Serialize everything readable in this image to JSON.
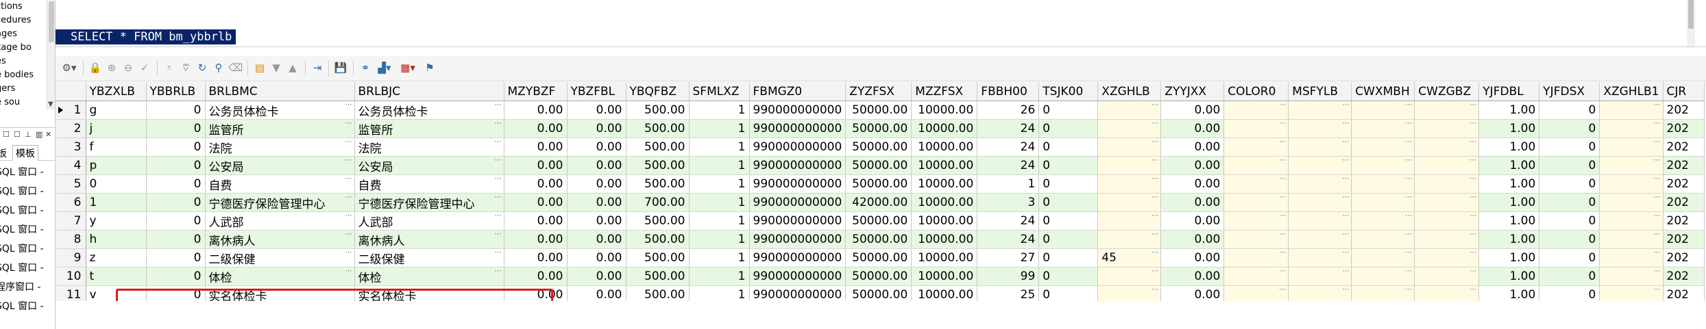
{
  "object_tree": [
    "ctions",
    "cedures",
    "ages",
    "kage bo",
    "es",
    "e bodies",
    "gers",
    "e sou"
  ],
  "panel_tabs": {
    "tab1": "板",
    "tab2": "模板"
  },
  "window_list": [
    "SQL 窗口 -",
    "SQL 窗口 -",
    "SQL 窗口 -",
    "SQL 窗口 -",
    "SQL 窗口 -",
    "SQL 窗口 -",
    "程序窗口 -",
    "SQL 窗口 -"
  ],
  "editor": {
    "sql_text": "SELECT * FROM bm_ybbrlb"
  },
  "grid": {
    "columns": [
      "YBZXLB",
      "YBBRLB",
      "BRLBMC",
      "BRLBJC",
      "MZYBZF",
      "YBZFBL",
      "YBQFBZ",
      "SFMLXZ",
      "FBMGZ0",
      "ZYZFSX",
      "MZZFSX",
      "FBBH00",
      "TSJK00",
      "XZGHLB",
      "ZYYJXX",
      "COLOR0",
      "MSFYLB",
      "CWXMBH",
      "CWZGBZ",
      "YJFDBL",
      "YJFDSX",
      "XZGHLB1",
      "CJR"
    ],
    "rows": [
      [
        "1",
        "g",
        "0",
        "公务员体检卡",
        "公务员体检卡",
        "0.00",
        "0.00",
        "500.00",
        "1",
        "990000000000",
        "50000.00",
        "10000.00",
        "26",
        "0",
        "",
        "0.00",
        "",
        "",
        "",
        "",
        "1.00",
        "0",
        "",
        "202"
      ],
      [
        "2",
        "j",
        "0",
        "监管所",
        "监管所",
        "0.00",
        "0.00",
        "500.00",
        "1",
        "990000000000",
        "50000.00",
        "10000.00",
        "24",
        "0",
        "",
        "0.00",
        "",
        "",
        "",
        "",
        "1.00",
        "0",
        "",
        "202"
      ],
      [
        "3",
        "f",
        "0",
        "法院",
        "法院",
        "0.00",
        "0.00",
        "500.00",
        "1",
        "990000000000",
        "50000.00",
        "10000.00",
        "24",
        "0",
        "",
        "0.00",
        "",
        "",
        "",
        "",
        "1.00",
        "0",
        "",
        "202"
      ],
      [
        "4",
        "p",
        "0",
        "公安局",
        "公安局",
        "0.00",
        "0.00",
        "500.00",
        "1",
        "990000000000",
        "50000.00",
        "10000.00",
        "24",
        "0",
        "",
        "0.00",
        "",
        "",
        "",
        "",
        "1.00",
        "0",
        "",
        "202"
      ],
      [
        "5",
        "0",
        "0",
        "自费",
        "自费",
        "0.00",
        "0.00",
        "500.00",
        "1",
        "990000000000",
        "50000.00",
        "10000.00",
        "1",
        "0",
        "",
        "0.00",
        "",
        "",
        "",
        "",
        "1.00",
        "0",
        "",
        "202"
      ],
      [
        "6",
        "1",
        "0",
        "宁德医疗保险管理中心",
        "宁德医疗保险管理中心",
        "0.00",
        "0.00",
        "700.00",
        "1",
        "990000000000",
        "42000.00",
        "10000.00",
        "3",
        "0",
        "",
        "0.00",
        "",
        "",
        "",
        "",
        "1.00",
        "0",
        "",
        "202"
      ],
      [
        "7",
        "y",
        "0",
        "人武部",
        "人武部",
        "0.00",
        "0.00",
        "500.00",
        "1",
        "990000000000",
        "50000.00",
        "10000.00",
        "24",
        "0",
        "",
        "0.00",
        "",
        "",
        "",
        "",
        "1.00",
        "0",
        "",
        "202"
      ],
      [
        "8",
        "h",
        "0",
        "离休病人",
        "离休病人",
        "0.00",
        "0.00",
        "500.00",
        "1",
        "990000000000",
        "50000.00",
        "10000.00",
        "24",
        "0",
        "",
        "0.00",
        "",
        "",
        "",
        "",
        "1.00",
        "0",
        "",
        "202"
      ],
      [
        "9",
        "z",
        "0",
        "二级保健",
        "二级保健",
        "0.00",
        "0.00",
        "500.00",
        "1",
        "990000000000",
        "50000.00",
        "10000.00",
        "27",
        "0",
        "45",
        "0.00",
        "",
        "",
        "",
        "",
        "1.00",
        "0",
        "",
        "202"
      ],
      [
        "10",
        "t",
        "0",
        "体检",
        "体检",
        "0.00",
        "0.00",
        "500.00",
        "1",
        "990000000000",
        "50000.00",
        "10000.00",
        "99",
        "0",
        "",
        "0.00",
        "",
        "",
        "",
        "",
        "1.00",
        "0",
        "",
        "202"
      ],
      [
        "11",
        "v",
        "0",
        "实名体检卡",
        "实名体检卡",
        "0.00",
        "0.00",
        "500.00",
        "1",
        "990000000000",
        "50000.00",
        "10000.00",
        "25",
        "0",
        "",
        "0.00",
        "",
        "",
        "",
        "",
        "1.00",
        "0",
        "",
        "202"
      ]
    ]
  },
  "colors": {
    "selection": "#0a246a",
    "alt_row": "#e6f8e1",
    "memo_cell": "#fffbe3",
    "highlight_box": "#e01818"
  }
}
